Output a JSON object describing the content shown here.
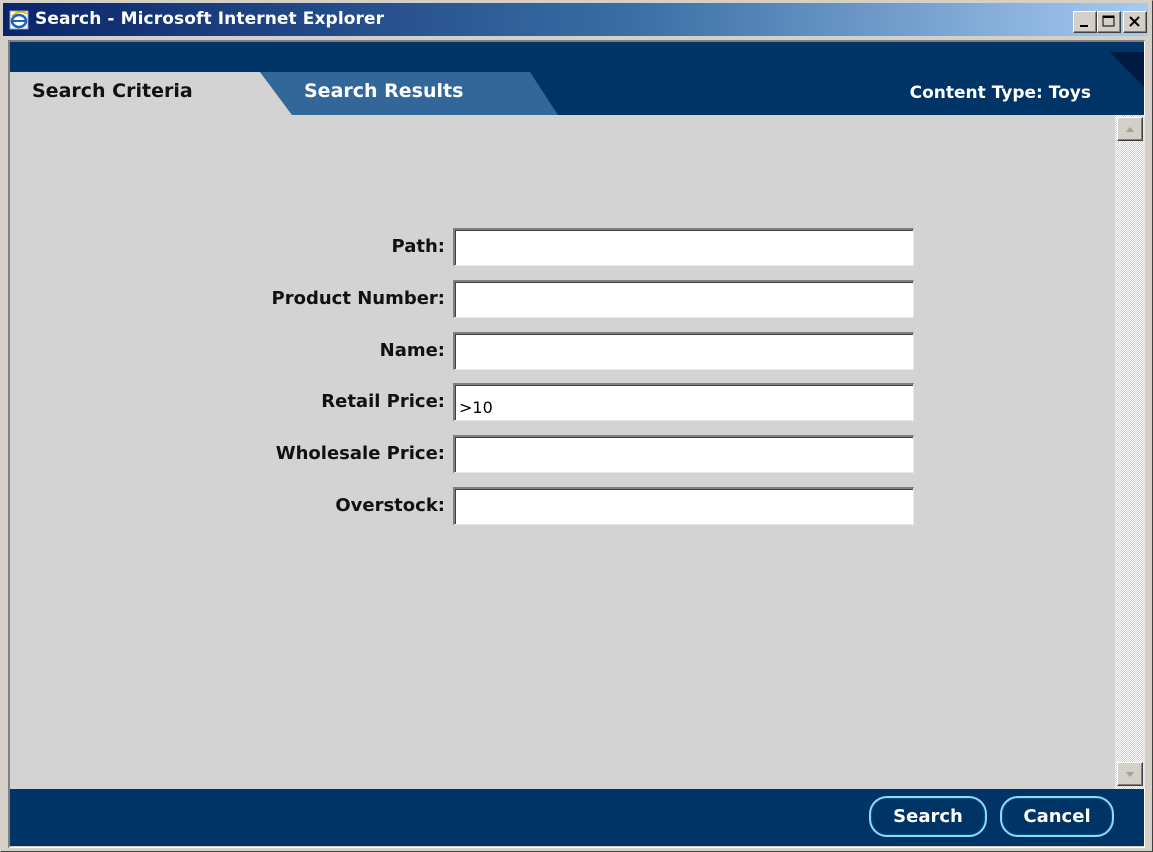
{
  "window": {
    "title": "Search - Microsoft Internet Explorer",
    "icon": "internet-explorer-icon",
    "controls": [
      "minimize",
      "maximize",
      "close"
    ]
  },
  "tabs": [
    {
      "label": "Search Criteria",
      "active": true
    },
    {
      "label": "Search Results",
      "active": false
    }
  ],
  "content_type": "Content Type: Toys",
  "form": {
    "fields": [
      {
        "label": "Path:",
        "value": ""
      },
      {
        "label": "Product Number:",
        "value": ""
      },
      {
        "label": "Name:",
        "value": ""
      },
      {
        "label": "Retail Price:",
        "value": ">10"
      },
      {
        "label": "Wholesale Price:",
        "value": ""
      },
      {
        "label": "Overstock:",
        "value": ""
      }
    ]
  },
  "buttons": {
    "search": "Search",
    "cancel": "Cancel"
  },
  "colors": {
    "header": "#003366",
    "tab_inactive": "#336699",
    "content_bg": "#d3d3d3",
    "button_outline": "#8fd8ff"
  }
}
